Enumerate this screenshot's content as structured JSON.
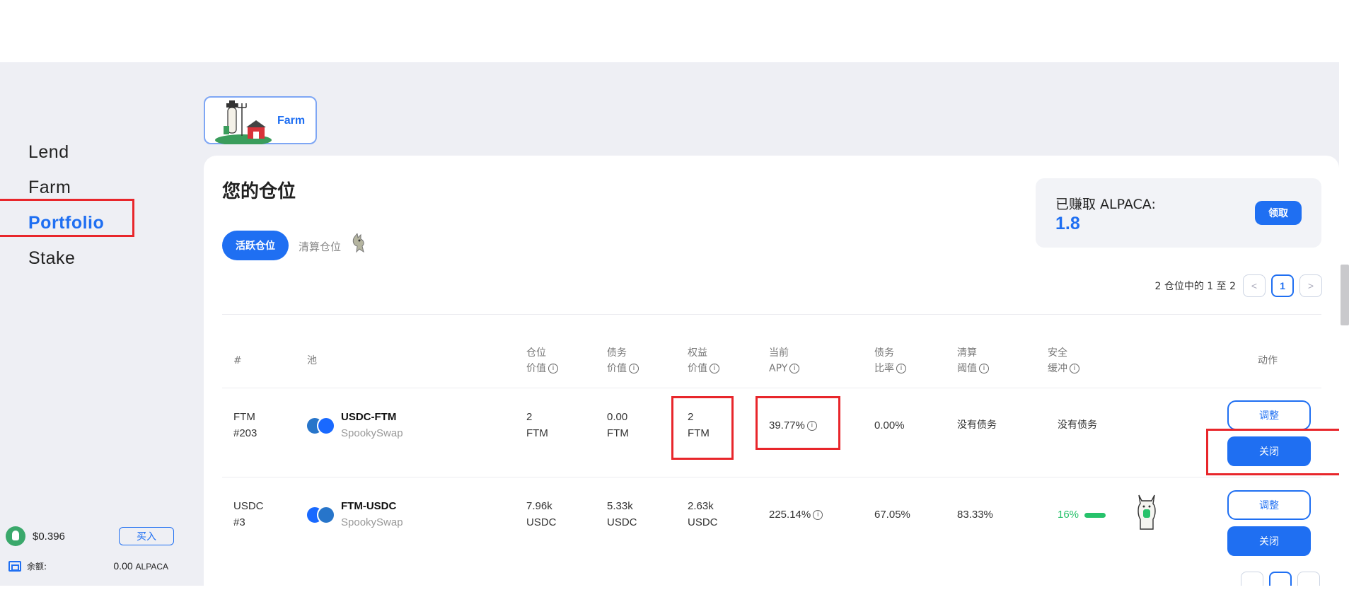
{
  "nav": [
    "Lend",
    "Farm",
    "Portfolio",
    "Stake"
  ],
  "sidebar_footer": {
    "price": "$0.396",
    "buy_label": "买入",
    "balance_label": "余额:",
    "balance_value": "0.00",
    "balance_unit": "ALPACA"
  },
  "farm_tab_label": "Farm",
  "card": {
    "title": "您的仓位",
    "tab_active": "活跃仓位",
    "tab_liquidated": "清算仓位",
    "earned_label": "已赚取 ALPACA:",
    "earned_value": "1.8",
    "claim_label": "领取",
    "page_info": "2 仓位中的 1 至 2",
    "page_current": "1"
  },
  "table": {
    "headers": {
      "num": "#",
      "pool": "池",
      "position_value": [
        "仓位",
        "价值"
      ],
      "debt_value": [
        "债务",
        "价值"
      ],
      "equity_value": [
        "权益",
        "价值"
      ],
      "current_apy": [
        "当前",
        "APY"
      ],
      "debt_ratio": [
        "债务",
        "比率"
      ],
      "liquidation": [
        "清算",
        "阈值"
      ],
      "safety": [
        "安全",
        "缓冲"
      ],
      "action": "动作"
    },
    "rows": [
      {
        "id": [
          "FTM",
          "#203"
        ],
        "pair": "USDC-FTM",
        "dex": "SpookySwap",
        "position_value": [
          "2",
          "FTM"
        ],
        "debt_value": [
          "0.00",
          "FTM"
        ],
        "equity_value": [
          "2",
          "FTM"
        ],
        "apy": "39.77%",
        "debt_ratio": "0.00%",
        "liquidation": "没有债务",
        "safety": "没有债务",
        "adjust": "调整",
        "close": "关闭"
      },
      {
        "id": [
          "USDC",
          "#3"
        ],
        "pair": "FTM-USDC",
        "dex": "SpookySwap",
        "position_value": [
          "7.96k",
          "USDC"
        ],
        "debt_value": [
          "5.33k",
          "USDC"
        ],
        "equity_value": [
          "2.63k",
          "USDC"
        ],
        "apy": "225.14%",
        "debt_ratio": "67.05%",
        "liquidation": "83.33%",
        "safety": "16%",
        "adjust": "调整",
        "close": "关闭"
      }
    ]
  },
  "colors": {
    "accent": "#1f6ff2",
    "highlight": "#e8262b",
    "safe_green": "#27c26b",
    "page_bg": "#eeeff4"
  }
}
